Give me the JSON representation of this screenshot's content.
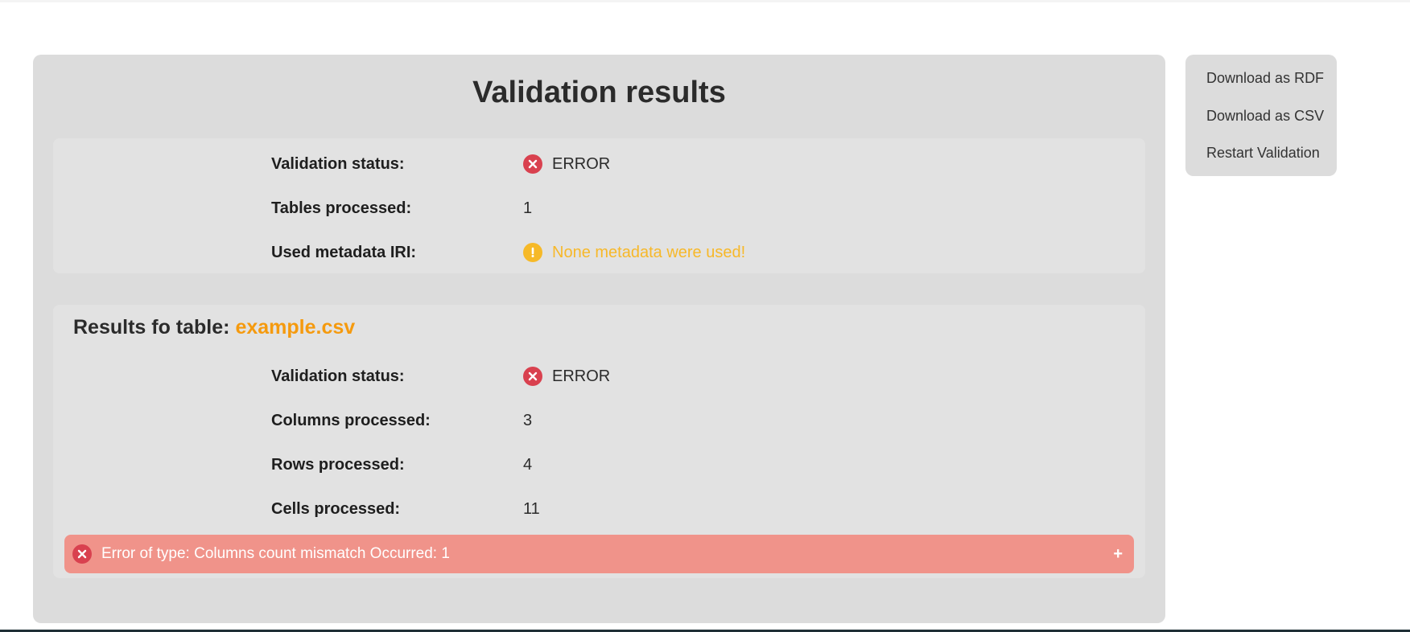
{
  "page": {
    "title": "Validation results"
  },
  "summary": {
    "validation_status": {
      "label": "Validation status:",
      "value": "ERROR"
    },
    "tables_processed": {
      "label": "Tables processed:",
      "value": "1"
    },
    "metadata_iri": {
      "label": "Used metadata IRI:",
      "value": "None metadata were used!"
    }
  },
  "table_result": {
    "heading_prefix": "Results fo table:",
    "table_name": "example.csv",
    "validation_status": {
      "label": "Validation status:",
      "value": "ERROR"
    },
    "columns_processed": {
      "label": "Columns processed:",
      "value": "3"
    },
    "rows_processed": {
      "label": "Rows processed:",
      "value": "4"
    },
    "cells_processed": {
      "label": "Cells processed:",
      "value": "11"
    },
    "error": {
      "text": "Error of type: Columns count mismatch Occurred: 1",
      "toggle": "+"
    }
  },
  "side_menu": {
    "items": [
      {
        "label": "Download as RDF"
      },
      {
        "label": "Download as CSV"
      },
      {
        "label": "Restart Validation"
      }
    ]
  },
  "icons": {
    "error_icon": "circle-x",
    "warning_icon": "circle-exclamation"
  },
  "colors": {
    "panel_bg": "#dcdcdc",
    "card_bg": "#e2e2e2",
    "error_red": "#d9414f",
    "error_bar": "#f0938a",
    "warning_yellow": "#f6b928",
    "table_name_orange": "#f59a0e"
  }
}
